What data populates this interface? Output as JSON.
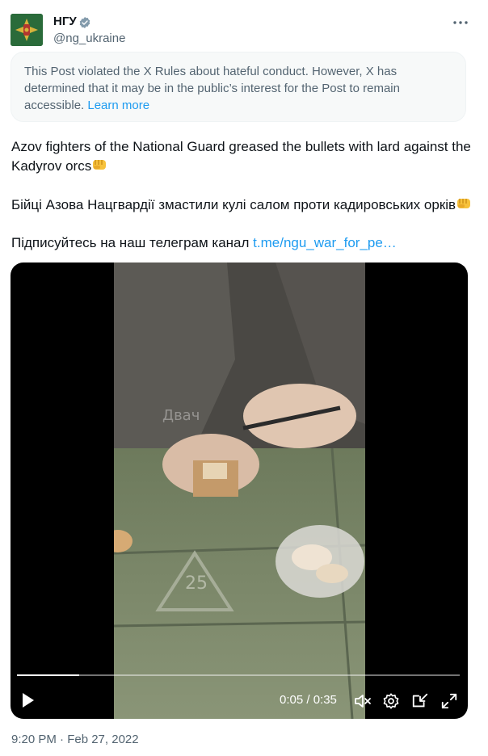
{
  "author": {
    "name": "НГУ",
    "handle": "@ng_ukraine",
    "verified": true
  },
  "notice": {
    "text": "This Post violated the X Rules about hateful conduct. However, X has determined that it may be in the public’s interest for the Post to remain accessible.",
    "link": "Learn more"
  },
  "post": {
    "line1": "Azov fighters of the National Guard greased the bullets with lard against the Kadyrov orcs",
    "line2": "Бійці Азова Нацгвардії змастили кулі салом проти кадировських орків",
    "line3_prefix": "Підписуйтесь на наш телеграм канал",
    "line3_link": "t.me/ngu_war_for_pe…",
    "emoji": "fist-emoji"
  },
  "video": {
    "time": "0:05 / 0:35",
    "progress": 0.14,
    "watermark": "Двач",
    "crate_number": "25",
    "icons": [
      "play-icon",
      "mute-icon",
      "settings-icon",
      "pip-icon",
      "fullscreen-icon"
    ]
  },
  "timestamp": "9:20 PM · Feb 27, 2022",
  "colors": {
    "link": "#1d9bf0",
    "muted": "#536471",
    "text": "#0f1419"
  }
}
